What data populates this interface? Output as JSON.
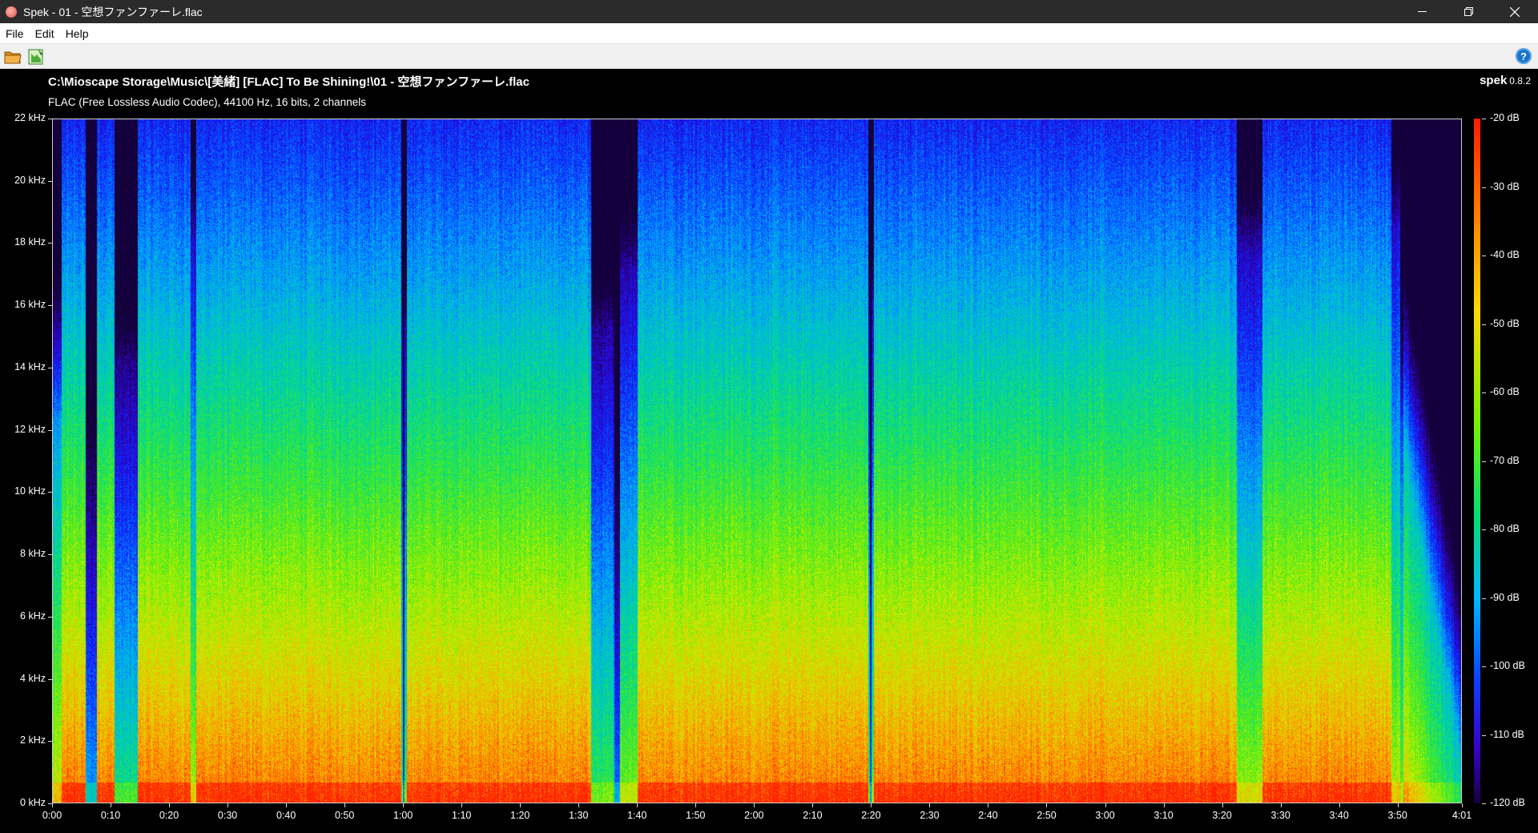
{
  "window": {
    "title": "Spek - 01 - 空想ファンファーレ.flac",
    "controls": [
      "minimize-icon",
      "restore-icon",
      "close-icon"
    ]
  },
  "menu": {
    "items": [
      "File",
      "Edit",
      "Help"
    ]
  },
  "toolbar": {
    "buttons": [
      "open-file-icon",
      "save-image-icon"
    ],
    "help_icon": "help-icon",
    "help_glyph": "?"
  },
  "spectrum": {
    "file_path": "C:\\Mioscape Storage\\Music\\[美緒] [FLAC] To Be Shining!\\01 - 空想ファンファーレ.flac",
    "file_info": "FLAC (Free Lossless Audio Codec), 44100 Hz, 16 bits, 2 channels",
    "brand": "spek",
    "version": "0.8.2",
    "y_axis_labels": [
      "22 kHz",
      "20 kHz",
      "18 kHz",
      "16 kHz",
      "14 kHz",
      "12 kHz",
      "10 kHz",
      "8 kHz",
      "6 kHz",
      "4 kHz",
      "2 kHz",
      "0 kHz"
    ],
    "x_axis_labels": [
      "0:00",
      "0:10",
      "0:20",
      "0:30",
      "0:40",
      "0:50",
      "1:00",
      "1:10",
      "1:20",
      "1:30",
      "1:40",
      "1:50",
      "2:00",
      "2:10",
      "2:20",
      "2:30",
      "2:40",
      "2:50",
      "3:00",
      "3:10",
      "3:20",
      "3:30",
      "3:40",
      "3:50",
      "4:01"
    ],
    "db_labels": [
      "-20 dB",
      "-30 dB",
      "-40 dB",
      "-50 dB",
      "-60 dB",
      "-70 dB",
      "-80 dB",
      "-90 dB",
      "-100 dB",
      "-110 dB",
      "-120 dB"
    ],
    "duration_seconds": 241,
    "max_frequency_khz": 22,
    "db_range": [
      -120,
      -20
    ],
    "colors": {
      "background": "#000000",
      "titlebar": "#2b2b2b",
      "menubar": "#ffffff",
      "toolbar": "#f0f0f0"
    }
  }
}
